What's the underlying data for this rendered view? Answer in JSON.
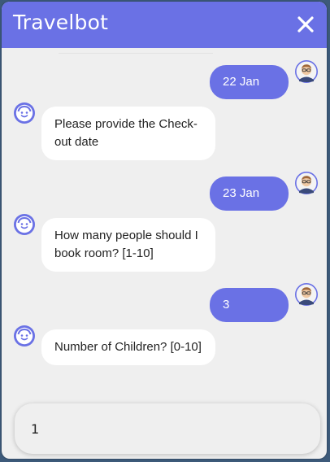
{
  "header": {
    "title": "Travelbot"
  },
  "messages": [
    {
      "sender": "user",
      "text": "22 Jan"
    },
    {
      "sender": "bot",
      "text": "Please provide the Check-out date"
    },
    {
      "sender": "user",
      "text": "23 Jan"
    },
    {
      "sender": "bot",
      "text": "How many people should I book room? [1-10]"
    },
    {
      "sender": "user",
      "text": "3"
    },
    {
      "sender": "bot",
      "text": "Number of Children? [0-10]"
    }
  ],
  "composer": {
    "value": "1"
  },
  "colors": {
    "accent": "#6a71e5",
    "background": "#efefef",
    "bot_bubble": "#ffffff"
  },
  "icons": {
    "close": "close-icon",
    "user_avatar": "user-avatar-icon",
    "bot_avatar": "bot-avatar-icon"
  }
}
